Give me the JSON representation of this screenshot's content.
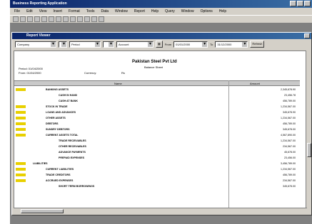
{
  "app": {
    "title": "Business Reporting Application"
  },
  "menu": [
    "File",
    "Edit",
    "View",
    "Insert",
    "Format",
    "Tools",
    "Data",
    "Window",
    "Report",
    "Help",
    "Query",
    "Window",
    "Options",
    "Help"
  ],
  "document": {
    "title": "Report Viewer"
  },
  "filters": {
    "company": "Company",
    "period": "Period",
    "view": "Account",
    "from_label": "From",
    "from_value": "01/01/2000",
    "to_label": "To",
    "to_value": "31/12/2000",
    "run_label": "Refresh"
  },
  "report": {
    "company_name": "Pakistan Steel Pvt Ltd",
    "subtitle": "Balance Sheet",
    "period_label": "Period: 01/04/2000",
    "from_label": "From: 01/04/2000",
    "currency_label": "Currency:",
    "currency_value": "Rs",
    "col_name": "Name",
    "col_amount": "Amount",
    "rows": [
      {
        "indent": 1,
        "name": "BANKING ASSETS",
        "amount": "2,345,678.90"
      },
      {
        "indent": 2,
        "name": "CASH IN HAND",
        "amount": "23,456.78"
      },
      {
        "indent": 2,
        "name": "CASH AT BANK",
        "amount": "456,789.00"
      },
      {
        "indent": 1,
        "name": "STOCK IN TRADE",
        "amount": "1,234,567.00"
      },
      {
        "indent": 1,
        "name": "LOANS AND ADVANCES",
        "amount": "345,678.90"
      },
      {
        "indent": 1,
        "name": "OTHER ASSETS",
        "amount": "1,234,567.00"
      },
      {
        "indent": 1,
        "name": "DEBTORS",
        "amount": "456,789.00"
      },
      {
        "indent": 1,
        "name": "SUNDRY DEBTORS",
        "amount": "345,678.00"
      },
      {
        "indent": 1,
        "name": "CURRENT ASSETS TOTAL",
        "amount": "4,567,890.00"
      },
      {
        "indent": 2,
        "name": "TRADE RECEIVABLES",
        "amount": "1,234,567.00"
      },
      {
        "indent": 2,
        "name": "OTHER RECEIVABLES",
        "amount": "234,567.00"
      },
      {
        "indent": 2,
        "name": "ADVANCE PAYMENTS",
        "amount": "45,678.00"
      },
      {
        "indent": 2,
        "name": "PREPAID EXPENSES",
        "amount": "23,456.00"
      },
      {
        "indent": 0,
        "name": "LIABILITIES",
        "amount": "3,456,789.00"
      },
      {
        "indent": 1,
        "name": "CURRENT LIABILITIES",
        "amount": "1,234,567.00"
      },
      {
        "indent": 1,
        "name": "TRADE CREDITORS",
        "amount": "456,789.00"
      },
      {
        "indent": 1,
        "name": "ACCRUED EXPENSES",
        "amount": "234,567.00"
      },
      {
        "indent": 2,
        "name": "SHORT TERM BORROWINGS",
        "amount": "345,678.00"
      }
    ]
  },
  "colors": {
    "mark": "#e8d000",
    "titlebar": "#0a246a"
  }
}
